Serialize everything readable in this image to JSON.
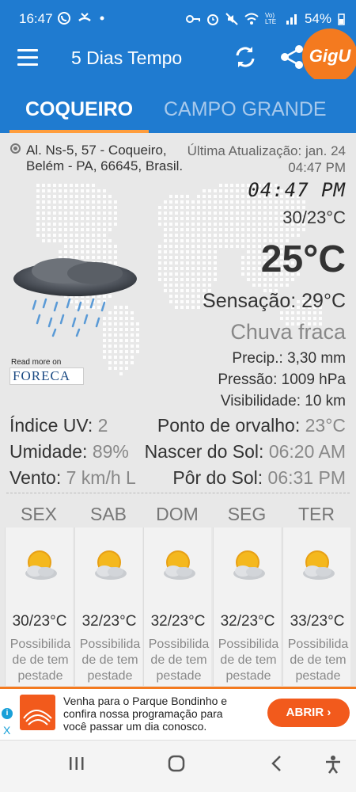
{
  "status": {
    "time": "16:47",
    "left_icons": [
      "whatsapp-icon",
      "missed-call-icon",
      "dot-icon"
    ],
    "right_icons": [
      "key-icon",
      "alarm-icon",
      "mute-icon",
      "wifi-icon",
      "volte-icon",
      "signal-icon"
    ],
    "battery": "54%",
    "volte": "Vo) LTE"
  },
  "appbar": {
    "title": "5 Dias Tempo",
    "badge": "GigU"
  },
  "tabs": [
    "COQUEIRO",
    "CAMPO GRANDE"
  ],
  "current": {
    "address": "Al. Ns-5, 57 - Coqueiro, Belém - PA, 66645, Brasil.",
    "updated_label": "Última Atualização: jan. 24  04:47 PM",
    "clock": "04:47 PM",
    "minmax": "30/23°C",
    "temperature": "25°C",
    "feels_like": "Sensação: 29°C",
    "condition": "Chuva fraca",
    "precip": "Precip.: 3,30 mm",
    "pressure": "Pressão: 1009 hPa",
    "visibility": "Visibilidade: 10 km",
    "read_more": "Read more on",
    "foreca_brand": "FORECA"
  },
  "stats": {
    "uv_label": "Índice UV:",
    "uv_value": "2",
    "humidity_label": "Umidade:",
    "humidity_value": "89%",
    "wind_label": "Vento:",
    "wind_value": "7 km/h L",
    "dew_label": "Ponto de orvalho:",
    "dew_value": "23°C",
    "sunrise_label": "Nascer do Sol:",
    "sunrise_value": "06:20 AM",
    "sunset_label": "Pôr do Sol:",
    "sunset_value": "06:31 PM"
  },
  "forecast": [
    {
      "day": "SEX",
      "minmax": "30/23°C",
      "desc": "Possibilidade de tempestade",
      "icon": "partly-sunny-icon"
    },
    {
      "day": "SAB",
      "minmax": "32/23°C",
      "desc": "Possibilidade de tempestade",
      "icon": "partly-sunny-icon"
    },
    {
      "day": "DOM",
      "minmax": "32/23°C",
      "desc": "Possibilidade de tempestade",
      "icon": "partly-sunny-icon"
    },
    {
      "day": "SEG",
      "minmax": "32/23°C",
      "desc": "Possibilidade de tempestade",
      "icon": "partly-sunny-icon"
    },
    {
      "day": "TER",
      "minmax": "33/23°C",
      "desc": "Possibilidade de tempestade",
      "icon": "partly-sunny-icon"
    }
  ],
  "ad": {
    "text": "Venha para o Parque Bondinho e confira nossa programação para você passar um dia conosco.",
    "cta": "ABRIR",
    "info": "i",
    "close": "X"
  },
  "colors": {
    "primary": "#1f7bd0",
    "accent": "#f47a1f",
    "ad_cta": "#f25a1c"
  }
}
